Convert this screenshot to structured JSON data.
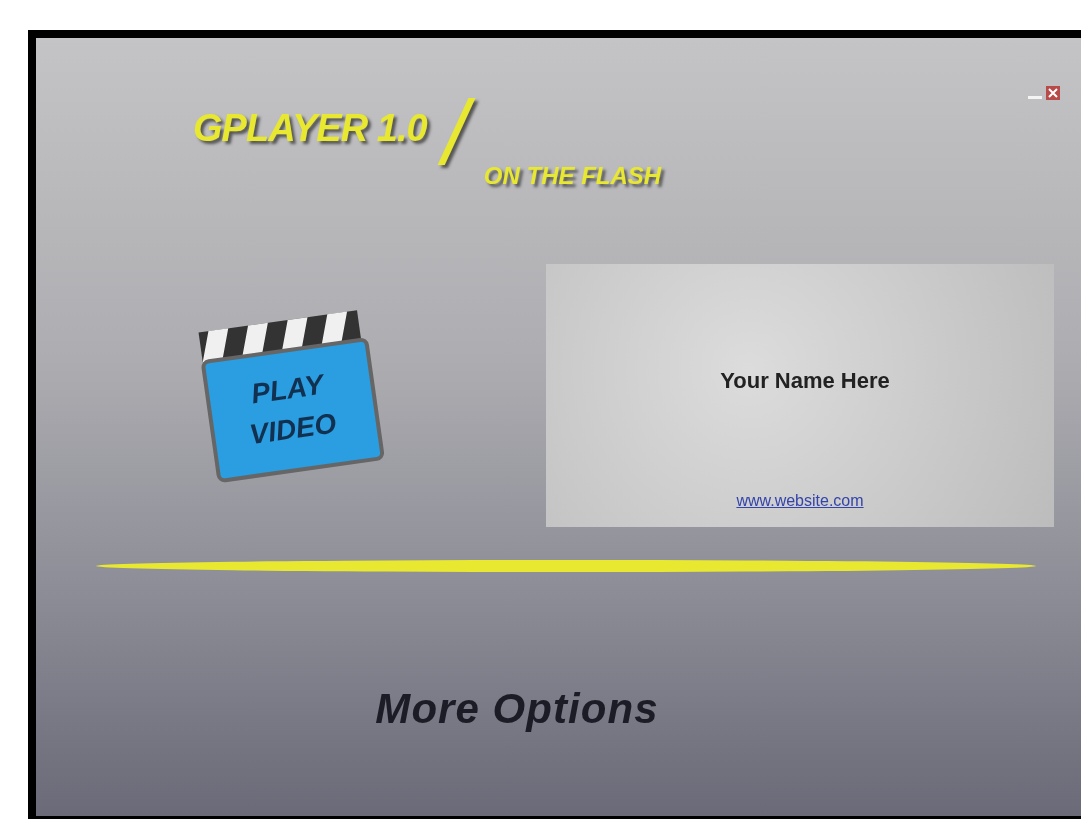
{
  "window": {
    "controls": [
      {
        "kind": "minimize"
      },
      {
        "kind": "close"
      }
    ]
  },
  "logo": {
    "title": "GPLAYER 1.0",
    "separator": "/",
    "subtitle": "ON THE FLASH"
  },
  "play_icon": {
    "lines": [
      "PLAY",
      "VIDEO"
    ]
  },
  "card": {
    "name": "Your Name Here",
    "link": "www.website.com"
  },
  "more_options": "More Options"
}
